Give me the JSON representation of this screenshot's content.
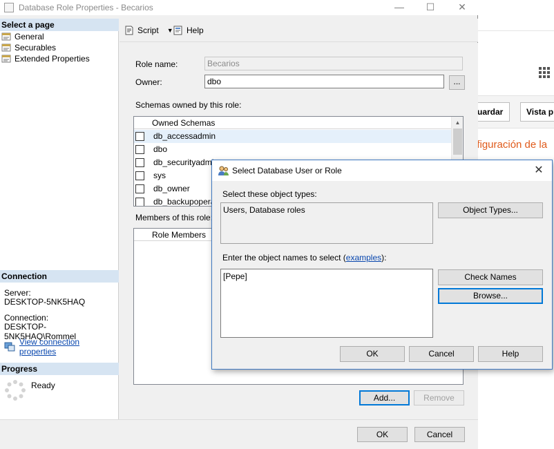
{
  "main_dialog": {
    "title": "Database Role Properties - Becarios",
    "window_controls": {
      "minimize": "—",
      "maximize": "☐",
      "close": "✕"
    }
  },
  "sidebar": {
    "select_page_header": "Select a page",
    "pages": [
      {
        "label": "General"
      },
      {
        "label": "Securables"
      },
      {
        "label": "Extended Properties"
      }
    ],
    "connection_header": "Connection",
    "server_label": "Server:",
    "server_value": "DESKTOP-5NK5HAQ",
    "connection_label": "Connection:",
    "connection_value": "DESKTOP-5NK5HAQ\\Rommel",
    "view_connection_link": "View connection properties",
    "progress_header": "Progress",
    "progress_status": "Ready"
  },
  "toolbar": {
    "script_label": "Script",
    "help_label": "Help"
  },
  "general": {
    "role_name_label": "Role name:",
    "role_name_value": "Becarios",
    "owner_label": "Owner:",
    "owner_value": "dbo",
    "browse_owner_label": "...",
    "schemas_label": "Schemas owned by this role:",
    "schemas_header": "Owned Schemas",
    "schemas": [
      {
        "name": "db_accessadmin",
        "checked": false
      },
      {
        "name": "dbo",
        "checked": false
      },
      {
        "name": "db_securityadmin",
        "checked": false
      },
      {
        "name": "sys",
        "checked": false
      },
      {
        "name": "db_owner",
        "checked": false
      },
      {
        "name": "db_backupoperator",
        "checked": false
      }
    ],
    "members_label": "Members of this role:",
    "members_header": "Role Members",
    "add_label": "Add...",
    "remove_label": "Remove"
  },
  "footer": {
    "ok_label": "OK",
    "cancel_label": "Cancel"
  },
  "select_dialog": {
    "title": "Select Database User or Role",
    "close": "✕",
    "object_types_label": "Select these object types:",
    "object_types_value": "Users, Database roles",
    "object_types_button": "Object Types...",
    "names_label_prefix": "Enter the object names to select (",
    "names_label_link": "examples",
    "names_label_suffix": "):",
    "names_value": "[Pepe]",
    "check_names_button": "Check Names",
    "browse_button": "Browse...",
    "ok_label": "OK",
    "cancel_label": "Cancel",
    "help_label": "Help"
  },
  "background_app": {
    "save_button": "uardar",
    "preview_button": "Vista pr",
    "heading_fragment": "nfiguración de la"
  },
  "colors": {
    "section_header": "#d6e4f2",
    "link": "#0645ad",
    "modal_border": "#3f79c2",
    "default_button_border": "#0078d7",
    "background_accent": "#e05a1a"
  }
}
